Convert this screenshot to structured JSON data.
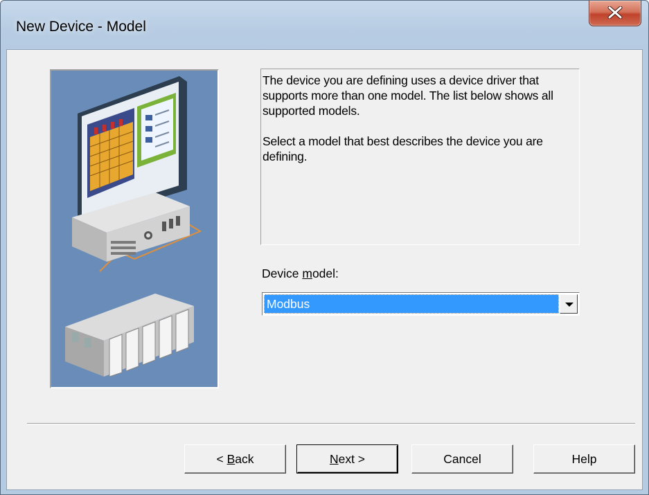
{
  "window": {
    "title": "New Device - Model",
    "close_symbol": "close-icon"
  },
  "description": {
    "paragraph1": "The device you are defining uses a device driver that supports more than one model.  The list below shows all supported models.",
    "paragraph2": "Select  a model that best describes the device you are defining."
  },
  "model": {
    "label_prefix": "Device ",
    "label_accel": "m",
    "label_suffix": "odel:",
    "selected": "Modbus"
  },
  "buttons": {
    "back_prefix": "< ",
    "back_accel": "B",
    "back_suffix": "ack",
    "next_accel": "N",
    "next_suffix": "ext >",
    "cancel": "Cancel",
    "help": "Help"
  },
  "colors": {
    "selection": "#3399ff",
    "illustration_bg": "#6a8cb8",
    "dialog_bg": "#f0f0f0",
    "close_button": "#c7503a"
  }
}
